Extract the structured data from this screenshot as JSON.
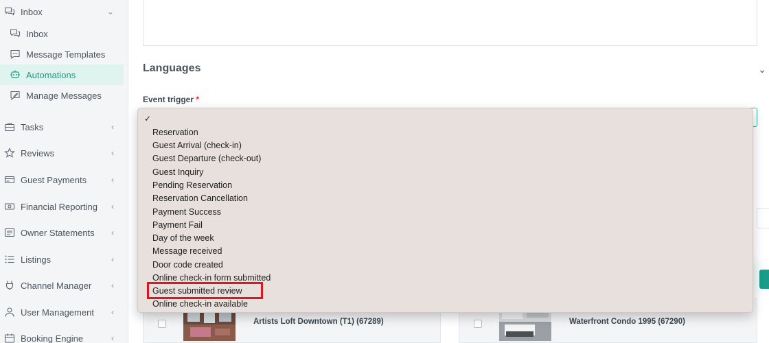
{
  "sidebar": {
    "items": [
      {
        "key": "inbox",
        "label": "Inbox",
        "icon": "chat-bubbles-icon",
        "chevron": "⌄"
      },
      {
        "key": "inbox-sub",
        "label": "Inbox",
        "icon": "chat-bubbles-icon"
      },
      {
        "key": "templates",
        "label": "Message Templates",
        "icon": "message-template-icon"
      },
      {
        "key": "automations",
        "label": "Automations",
        "icon": "automations-icon"
      },
      {
        "key": "manage",
        "label": "Manage Messages",
        "icon": "manage-messages-icon"
      },
      {
        "key": "tasks",
        "label": "Tasks",
        "icon": "briefcase-icon",
        "chevron": "‹"
      },
      {
        "key": "reviews",
        "label": "Reviews",
        "icon": "star-icon",
        "chevron": "‹"
      },
      {
        "key": "guest-payments",
        "label": "Guest Payments",
        "icon": "credit-card-icon",
        "chevron": "‹"
      },
      {
        "key": "financial",
        "label": "Financial Reporting",
        "icon": "money-icon",
        "chevron": "‹"
      },
      {
        "key": "owner",
        "label": "Owner Statements",
        "icon": "statement-icon",
        "chevron": "‹"
      },
      {
        "key": "listings",
        "label": "Listings",
        "icon": "list-icon",
        "chevron": "‹"
      },
      {
        "key": "channel",
        "label": "Channel Manager",
        "icon": "plug-icon",
        "chevron": "‹"
      },
      {
        "key": "users",
        "label": "User Management",
        "icon": "user-icon",
        "chevron": "‹"
      },
      {
        "key": "booking",
        "label": "Booking Engine",
        "icon": "booking-icon",
        "chevron": "‹"
      }
    ]
  },
  "main": {
    "languages_title": "Languages",
    "languages_chevron": "⌄",
    "event_trigger_label": "Event trigger",
    "required_mark": "*"
  },
  "dropdown": {
    "checkmark": "✓",
    "options": [
      "Reservation",
      "Guest Arrival (check-in)",
      "Guest Departure (check-out)",
      "Guest Inquiry",
      "Pending Reservation",
      "Reservation Cancellation",
      "Payment Success",
      "Payment Fail",
      "Day of the week",
      "Message received",
      "Door code created",
      "Online check-in form submitted",
      "Guest submitted review",
      "Online check-in available"
    ],
    "highlighted_option": "Guest submitted review"
  },
  "listings": [
    {
      "name": "Artists Loft Downtown (T1) (67289)"
    },
    {
      "name": "Waterfront Condo 1995 (67290)"
    }
  ],
  "colors": {
    "accent": "#1a9c8a",
    "highlight_border": "#e0151d",
    "dropdown_bg": "#e8e0dd"
  }
}
